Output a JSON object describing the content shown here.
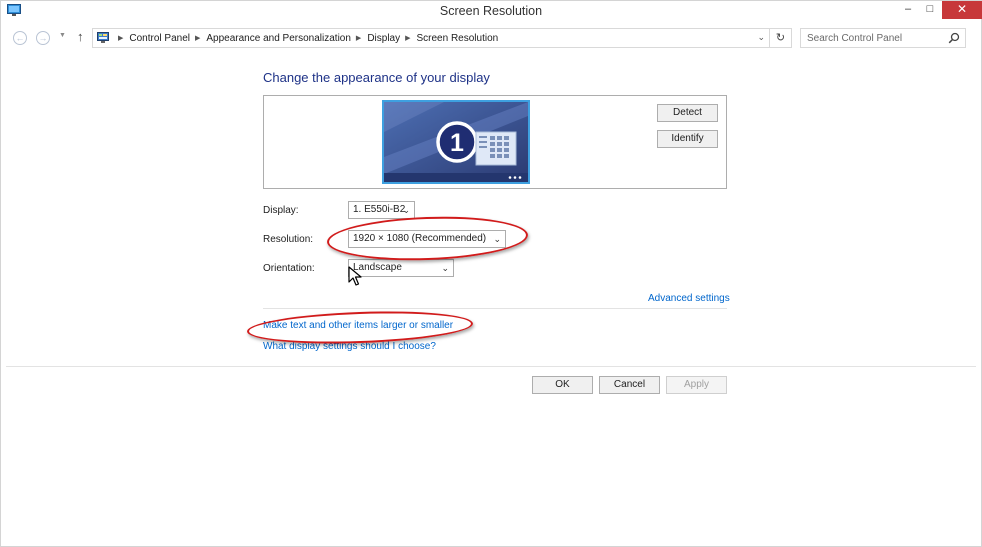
{
  "window": {
    "title": "Screen Resolution"
  },
  "title_controls": {
    "minimize": "–",
    "maximize": "□",
    "close": "✕"
  },
  "nav": {
    "back": "←",
    "forward": "→",
    "recent": "▼",
    "up": "↑",
    "breadcrumbs": [
      "Control Panel",
      "Appearance and Personalization",
      "Display",
      "Screen Resolution"
    ],
    "separator": "▶",
    "dropdown": "⌄",
    "refresh": "↻"
  },
  "search": {
    "placeholder": "Search Control Panel"
  },
  "main": {
    "heading": "Change the appearance of your display",
    "monitor_number": "1",
    "detect_label": "Detect",
    "identify_label": "Identify",
    "display_label": "Display:",
    "display_value": "1. E550i-B2",
    "resolution_label": "Resolution:",
    "resolution_value": "1920 × 1080 (Recommended)",
    "orientation_label": "Orientation:",
    "orientation_value": "Landscape",
    "chevron": "⌄",
    "advanced_link": "Advanced settings",
    "text_size_link": "Make text and other items larger or smaller",
    "help_link": "What display settings should I choose?"
  },
  "footer": {
    "ok_label": "OK",
    "cancel_label": "Cancel",
    "apply_label": "Apply"
  },
  "colors": {
    "heading": "#1e3287",
    "link": "#0066cc",
    "annotation": "#d11b1b",
    "monitor_border": "#3ea0e0",
    "close_button": "#c7383a"
  }
}
